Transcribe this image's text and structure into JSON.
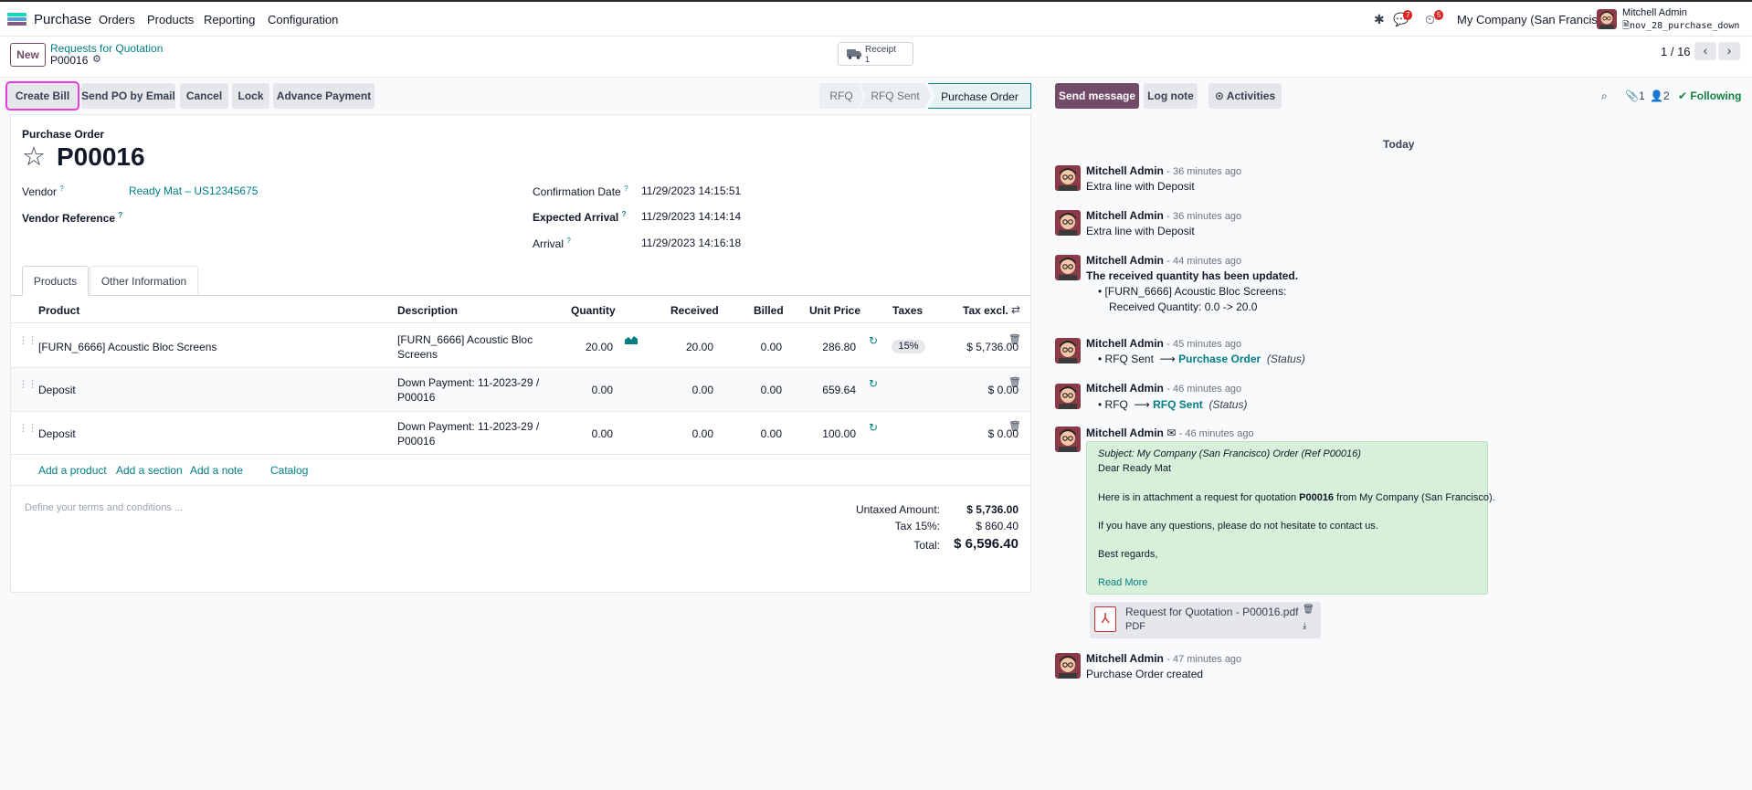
{
  "nav": {
    "app_name": "Purchase",
    "menu": [
      "Orders",
      "Products",
      "Reporting",
      "Configuration"
    ],
    "messages_count": "7",
    "activities_count": "5",
    "company": "My Company (San Francisco)",
    "user_name": "Mitchell Admin",
    "user_db": "nov_28_purchase_down"
  },
  "control": {
    "new_label": "New",
    "breadcrumb": "Requests for Quotation",
    "record": "P00016",
    "receipt_label": "Receipt",
    "receipt_count": "1",
    "pager": "1 / 16"
  },
  "actions": [
    "Create Bill",
    "Send PO by Email",
    "Cancel",
    "Lock",
    "Advance Payment"
  ],
  "stages": {
    "rfq": "RFQ",
    "rfq_sent": "RFQ Sent",
    "po": "Purchase Order"
  },
  "form": {
    "subtitle": "Purchase Order",
    "title": "P00016",
    "vendor_label": "Vendor",
    "vendor_value": "Ready Mat – US12345675",
    "vendor_ref_label": "Vendor Reference",
    "confirmation_label": "Confirmation Date",
    "confirmation_value": "11/29/2023 14:15:51",
    "expected_label": "Expected Arrival",
    "expected_value": "11/29/2023 14:14:14",
    "arrival_label": "Arrival",
    "arrival_value": "11/29/2023 14:16:18"
  },
  "tabs": [
    "Products",
    "Other Information"
  ],
  "table": {
    "headers": {
      "product": "Product",
      "description": "Description",
      "quantity": "Quantity",
      "received": "Received",
      "billed": "Billed",
      "unit_price": "Unit Price",
      "taxes": "Taxes",
      "tax_excl": "Tax excl."
    },
    "rows": [
      {
        "product": "[FURN_6666] Acoustic Bloc Screens",
        "desc1": "[FURN_6666] Acoustic Bloc",
        "desc2": "Screens",
        "quantity": "20.00",
        "received": "20.00",
        "billed": "0.00",
        "unit_price": "286.80",
        "tax": "15%",
        "subtotal": "$ 5,736.00"
      },
      {
        "product": "Deposit",
        "desc1": "Down Payment: 11-2023-29 /",
        "desc2": "P00016",
        "quantity": "0.00",
        "received": "0.00",
        "billed": "0.00",
        "unit_price": "659.64",
        "tax": "",
        "subtotal": "$ 0.00"
      },
      {
        "product": "Deposit",
        "desc1": "Down Payment: 11-2023-29 /",
        "desc2": "P00016",
        "quantity": "0.00",
        "received": "0.00",
        "billed": "0.00",
        "unit_price": "100.00",
        "tax": "",
        "subtotal": "$ 0.00"
      }
    ],
    "add_product": "Add a product",
    "add_section": "Add a section",
    "add_note": "Add a note",
    "catalog": "Catalog"
  },
  "totals": {
    "terms_placeholder": "Define your terms and conditions ...",
    "untaxed_label": "Untaxed Amount:",
    "untaxed_value": "$ 5,736.00",
    "tax_label": "Tax 15%:",
    "tax_value": "$ 860.40",
    "total_label": "Total:",
    "total_value": "$ 6,596.40"
  },
  "chatter": {
    "send_message": "Send message",
    "log_note": "Log note",
    "activities": "Activities",
    "attachments_count": "1",
    "followers_count": "2",
    "following": "Following",
    "today": "Today",
    "author": "Mitchell Admin",
    "messages": [
      {
        "time": "- 36 minutes ago",
        "body": "Extra line with Deposit"
      },
      {
        "time": "- 36 minutes ago",
        "body": "Extra line with Deposit"
      },
      {
        "time": "- 44 minutes ago",
        "body": "The received quantity has been updated.",
        "bullet1": "[FURN_6666] Acoustic Bloc Screens:",
        "bullet2": "Received Quantity: 0.0 -> 20.0"
      },
      {
        "time": "- 45 minutes ago",
        "from": "RFQ Sent",
        "to": "Purchase Order",
        "field": "(Status)"
      },
      {
        "time": "- 46 minutes ago",
        "from": "RFQ",
        "to": "RFQ Sent",
        "field": "(Status)"
      },
      {
        "time": "- 46 minutes ago"
      },
      {
        "time": "- 47 minutes ago",
        "body": "Purchase Order created"
      }
    ],
    "mail": {
      "subject": "Subject: My Company (San Francisco) Order (Ref P00016)",
      "greeting": "Dear Ready Mat",
      "line1_a": "Here is in attachment a request for quotation ",
      "line1_b": "P00016",
      "line1_c": " from My Company (San Francisco).",
      "line2": "If you have any questions, please do not hesitate to contact us.",
      "regards": "Best regards,",
      "read_more": "Read More"
    },
    "attachment_name": "Request for Quotation - P00016.pdf",
    "attachment_type": "PDF"
  }
}
